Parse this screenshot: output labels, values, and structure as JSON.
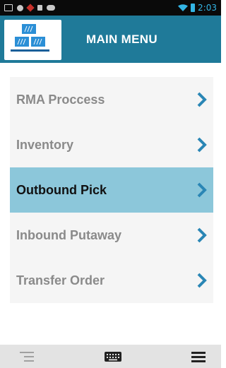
{
  "status_bar": {
    "time": "2:03",
    "icons": [
      "picture-icon",
      "circle-icon",
      "diamond-alert-icon",
      "small-square-icon",
      "cloud-icon",
      "wifi-icon",
      "battery-icon"
    ]
  },
  "header": {
    "title": "MAIN MENU",
    "logo_icon": "warehouse-boxes-icon"
  },
  "menu": {
    "items": [
      {
        "label": "RMA Proccess",
        "active": false
      },
      {
        "label": "Inventory",
        "active": false
      },
      {
        "label": "Outbound Pick",
        "active": true
      },
      {
        "label": "Inbound Putaway",
        "active": false
      },
      {
        "label": "Transfer Order",
        "active": false
      }
    ]
  },
  "nav_bar": {
    "icons": [
      "menu-lines-icon",
      "keyboard-icon",
      "hamburger-icon"
    ]
  },
  "colors": {
    "header_bg": "#1f7a99",
    "active_item_bg": "#8cc7da",
    "chevron": "#2a86b5",
    "clock": "#33b5e5"
  }
}
